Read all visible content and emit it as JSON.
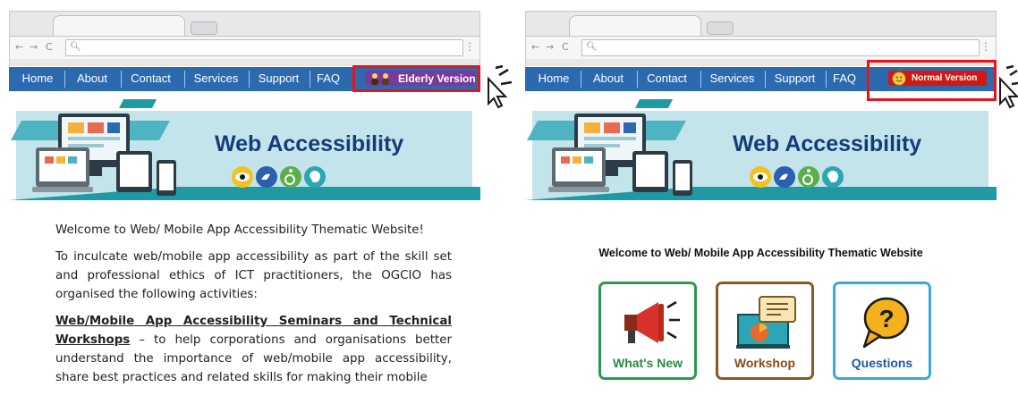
{
  "left_window": {
    "nav": [
      "Home",
      "About",
      "Contact",
      "Services",
      "Support",
      "FAQ"
    ],
    "version_button": "Elderly Version",
    "banner_title": "Web Accessibility",
    "paragraphs": {
      "welcome": "Welcome to Web/ Mobile App Accessibility Thematic Website!",
      "intro": "To inculcate web/mobile app accessibility as part of the skill set and professional ethics of ICT practitioners, the OGCIO has organised the following activities:",
      "seminar_heading": "Web/Mobile App Accessibility Seminars and Technical Workshops",
      "seminar_body": " – to help corporations and organisations better understand the importance of web/mobile app accessibility, share best practices and related skills for making their mobile"
    }
  },
  "right_window": {
    "nav": [
      "Home",
      "About",
      "Contact",
      "Services",
      "Support",
      "FAQ"
    ],
    "version_button": "Normal Version",
    "banner_title": "Web Accessibility",
    "welcome": "Welcome to Web/ Mobile App Accessibility Thematic Website",
    "tiles": [
      {
        "label": "What's New",
        "color": "#2a9a4e"
      },
      {
        "label": "Workshop",
        "color": "#8a5a1c"
      },
      {
        "label": "Questions",
        "color": "#3aa8de"
      }
    ]
  },
  "colors": {
    "navbar": "#2c6ab0",
    "elderly_button": "#7a3a9a",
    "normal_button": "#cc1b12",
    "highlight": "#e8141a",
    "banner_title": "#173a7a",
    "banner_teal": "#1f9aa3"
  },
  "icons": [
    "eye-icon",
    "sign-language-icon",
    "wheelchair-icon",
    "brain-icon",
    "megaphone-icon",
    "presentation-icon",
    "question-bubble-icon",
    "cursor-icon"
  ]
}
